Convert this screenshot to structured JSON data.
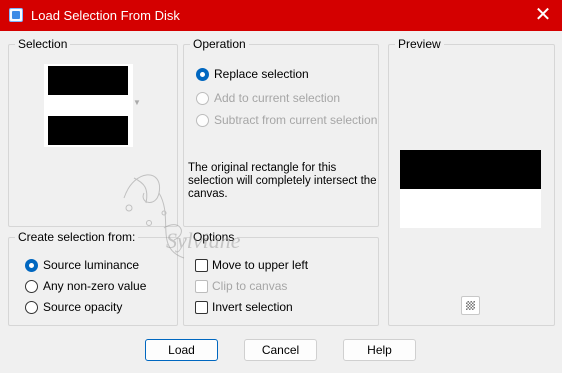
{
  "window": {
    "title": "Load Selection From Disk",
    "close_symbol": "✕"
  },
  "selection": {
    "group_label": "Selection"
  },
  "operation": {
    "group_label": "Operation",
    "options": [
      {
        "label": "Replace selection",
        "checked": true,
        "enabled": true
      },
      {
        "label": "Add to current selection",
        "checked": false,
        "enabled": false
      },
      {
        "label": "Subtract from current selection",
        "checked": false,
        "enabled": false
      }
    ],
    "info_text": "The original rectangle for this selection will completely intersect the canvas."
  },
  "preview": {
    "group_label": "Preview"
  },
  "create_from": {
    "group_label": "Create selection from:",
    "options": [
      {
        "label": "Source luminance",
        "checked": true
      },
      {
        "label": "Any non-zero value",
        "checked": false
      },
      {
        "label": "Source opacity",
        "checked": false
      }
    ]
  },
  "options": {
    "group_label": "Options",
    "items": [
      {
        "label": "Move to upper left",
        "checked": false,
        "enabled": true
      },
      {
        "label": "Clip to canvas",
        "checked": false,
        "enabled": false
      },
      {
        "label": "Invert selection",
        "checked": false,
        "enabled": true
      }
    ]
  },
  "buttons": {
    "load": "Load",
    "cancel": "Cancel",
    "help": "Help"
  },
  "watermark_text": "Sylviane",
  "colors": {
    "titlebar": "#d40000",
    "accent": "#0067c0",
    "dialog_bg": "#f0f0f0"
  }
}
